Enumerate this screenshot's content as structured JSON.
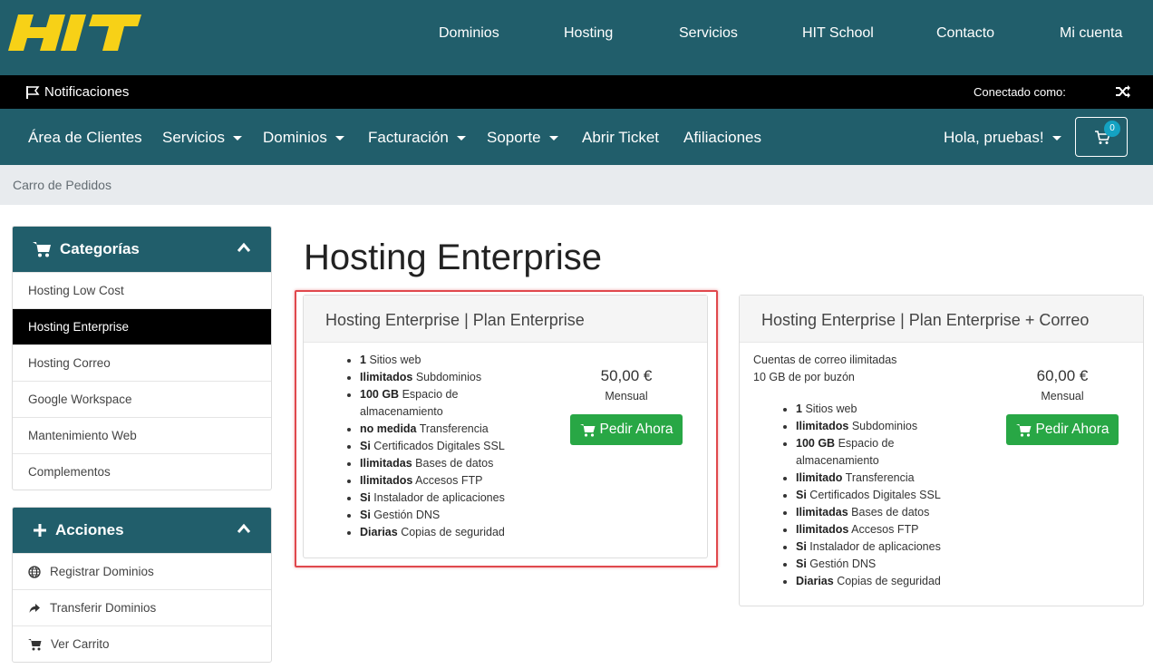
{
  "brand": {
    "logo_text": "HIT",
    "logo_color": "#f7d117",
    "bar_color": "#215e6b"
  },
  "top_nav": [
    "Dominios",
    "Hosting",
    "Servicios",
    "HIT School",
    "Contacto",
    "Mi cuenta"
  ],
  "notif_bar": {
    "notifications_label": "Notificaciones",
    "connected_label": "Conectado como:"
  },
  "main_nav": {
    "items": [
      "Área de Clientes",
      "Servicios",
      "Dominios",
      "Facturación",
      "Soporte",
      "Abrir Ticket",
      "Afiliaciones"
    ],
    "greeting": "Hola, pruebas!",
    "cart_count": "0"
  },
  "breadcrumb": "Carro de Pedidos",
  "categories": {
    "title": "Categorías",
    "items": [
      "Hosting Low Cost",
      "Hosting Enterprise",
      "Hosting Correo",
      "Google Workspace",
      "Mantenimiento Web",
      "Complementos"
    ],
    "active": "Hosting Enterprise"
  },
  "actions": {
    "title": "Acciones",
    "items": [
      "Registrar Dominios",
      "Transferir Dominios",
      "Ver Carrito"
    ]
  },
  "page_title": "Hosting Enterprise",
  "plans": [
    {
      "name": "Hosting Enterprise | Plan Enterprise",
      "description": [],
      "features": [
        [
          "1",
          "Sitios web"
        ],
        [
          "Ilimitados",
          "Subdominios"
        ],
        [
          "100 GB",
          "Espacio de almacenamiento"
        ],
        [
          "no medida",
          "Transferencia"
        ],
        [
          "Si",
          "Certificados Digitales SSL"
        ],
        [
          "Ilimitadas",
          "Bases de datos"
        ],
        [
          "Ilimitados",
          "Accesos FTP"
        ],
        [
          "Si",
          "Instalador de aplicaciones"
        ],
        [
          "Si",
          "Gestión DNS"
        ],
        [
          "Diarias",
          "Copias de seguridad"
        ]
      ],
      "price": "50,00 €",
      "cycle": "Mensual",
      "button": "Pedir Ahora"
    },
    {
      "name": "Hosting Enterprise | Plan Enterprise + Correo",
      "description": [
        "Cuentas de correo ilimitadas",
        "10 GB de por buzón"
      ],
      "features": [
        [
          "1",
          "Sitios web"
        ],
        [
          "Ilimitados",
          "Subdominios"
        ],
        [
          "100 GB",
          "Espacio de almacenamiento"
        ],
        [
          "Ilimitado",
          "Transferencia"
        ],
        [
          "Si",
          "Certificados Digitales SSL"
        ],
        [
          "Ilimitadas",
          "Bases de datos"
        ],
        [
          "Ilimitados",
          "Accesos FTP"
        ],
        [
          "Si",
          "Instalador de aplicaciones"
        ],
        [
          "Si",
          "Gestión DNS"
        ],
        [
          "Diarias",
          "Copias de seguridad"
        ]
      ],
      "price": "60,00 €",
      "cycle": "Mensual",
      "button": "Pedir Ahora"
    }
  ]
}
